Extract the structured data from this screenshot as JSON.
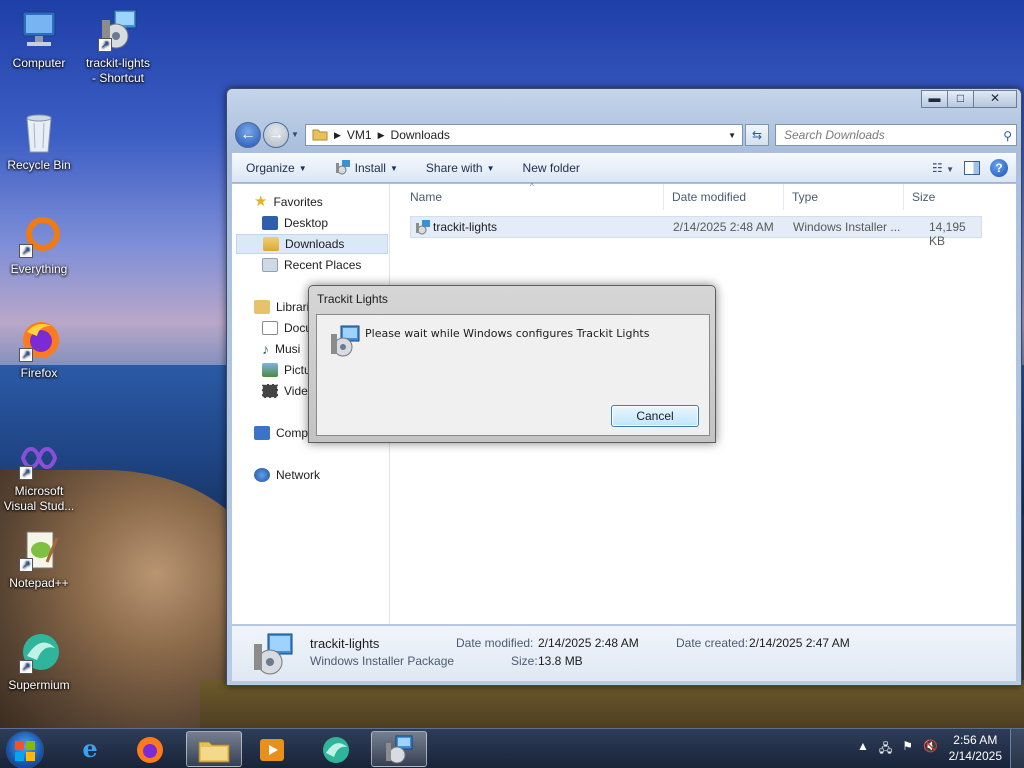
{
  "desktop": {
    "icons": [
      {
        "label": "Computer",
        "icon": "computer-icon"
      },
      {
        "label": "trackit-lights\n- Shortcut",
        "icon": "installer-icon"
      },
      {
        "label": "Recycle Bin",
        "icon": "recycle-bin-icon"
      },
      {
        "label": "Everything",
        "icon": "everything-search-icon"
      },
      {
        "label": "Firefox",
        "icon": "firefox-icon"
      },
      {
        "label": "Microsoft\nVisual Stud...",
        "icon": "visual-studio-icon"
      },
      {
        "label": "Notepad++",
        "icon": "notepadpp-icon"
      },
      {
        "label": "Supermium",
        "icon": "supermium-icon"
      }
    ]
  },
  "explorer": {
    "title_buttons": {
      "minimize": "▬",
      "maximize": "□",
      "close": "✕"
    },
    "address": {
      "root": "VM1",
      "current": "Downloads"
    },
    "search_placeholder": "Search Downloads",
    "toolbar": {
      "organize": "Organize",
      "install": "Install",
      "share_with": "Share with",
      "new_folder": "New folder"
    },
    "nav": {
      "favorites": "Favorites",
      "desktop": "Desktop",
      "downloads": "Downloads",
      "recent_places": "Recent Places",
      "libraries": "Librari",
      "documents": "Docu",
      "music": "Musi",
      "pictures": "Pictu",
      "videos": "Video",
      "computer": "Comp",
      "network": "Network"
    },
    "columns": {
      "name": "Name",
      "date_modified": "Date modified",
      "type": "Type",
      "size": "Size"
    },
    "files": [
      {
        "name": "trackit-lights",
        "date_modified": "2/14/2025 2:48 AM",
        "type": "Windows Installer ...",
        "size": "14,195 KB"
      }
    ],
    "details": {
      "name": "trackit-lights",
      "kind": "Windows Installer Package",
      "date_modified_label": "Date modified:",
      "date_modified": "2/14/2025 2:48 AM",
      "size_label": "Size:",
      "size": "13.8 MB",
      "date_created_label": "Date created:",
      "date_created": "2/14/2025 2:47 AM"
    }
  },
  "dialog": {
    "title": "Trackit Lights",
    "message": "Please wait while Windows configures Trackit Lights",
    "cancel": "Cancel"
  },
  "taskbar": {
    "start": "start-orb",
    "apps": [
      "internet-explorer-icon",
      "firefox-icon",
      "file-explorer-icon",
      "media-player-icon",
      "supermium-icon",
      "installer-icon"
    ],
    "time": "2:56 AM",
    "date": "2/14/2025"
  }
}
